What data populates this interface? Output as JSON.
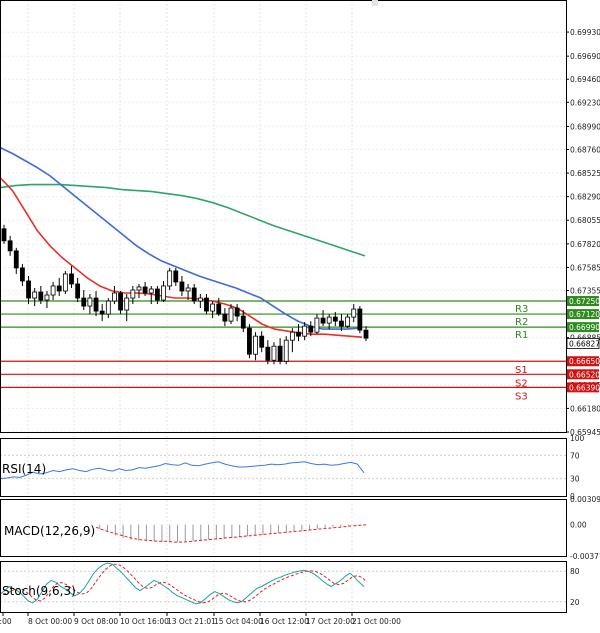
{
  "chart_data": {
    "type": "candlestick",
    "main": {
      "ylim": [
        0.65945,
        0.7015
      ],
      "yticks": [
        "0.69930",
        "0.69690",
        "0.69460",
        "0.69230",
        "0.68990",
        "0.68760",
        "0.68525",
        "0.68290",
        "0.68055",
        "0.67820",
        "0.67585",
        "0.67355",
        "0.67120",
        "0.66885",
        "0.66650",
        "0.66415",
        "0.66180",
        "0.65945"
      ],
      "xticks": [
        "20:00",
        "8 Oct 00:00",
        "9 Oct 08:00",
        "10 Oct 16:00",
        "13 Oct 21:01",
        "15 Oct 04:00",
        "16 Oct 12:00",
        "17 Oct 20:00",
        "21 Oct 00:00"
      ],
      "current_price": {
        "label": "0.66827",
        "value": 0.66827
      },
      "levels": [
        {
          "name": "R3",
          "label": "0.67250",
          "value": 0.6725,
          "color": "#2e8b1e"
        },
        {
          "name": "R2",
          "label": "0.67120",
          "value": 0.6712,
          "color": "#2e8b1e"
        },
        {
          "name": "R1",
          "label": "0.66990",
          "value": 0.6699,
          "color": "#2e8b1e"
        },
        {
          "name": "S1",
          "label": "0.66650",
          "value": 0.6665,
          "color": "#d41010"
        },
        {
          "name": "S2",
          "label": "0.66520",
          "value": 0.6652,
          "color": "#d41010"
        },
        {
          "name": "S3",
          "label": "0.66390",
          "value": 0.6639,
          "color": "#d41010"
        }
      ],
      "candles": [
        [
          0.6797,
          0.6801,
          0.6782,
          0.6785
        ],
        [
          0.6785,
          0.679,
          0.677,
          0.6775
        ],
        [
          0.6775,
          0.6778,
          0.6752,
          0.6758
        ],
        [
          0.6758,
          0.6762,
          0.674,
          0.6745
        ],
        [
          0.6745,
          0.675,
          0.6722,
          0.6728
        ],
        [
          0.6728,
          0.6738,
          0.672,
          0.6734
        ],
        [
          0.6734,
          0.674,
          0.6722,
          0.6726
        ],
        [
          0.6726,
          0.6735,
          0.6718,
          0.6731
        ],
        [
          0.6731,
          0.6744,
          0.6726,
          0.674
        ],
        [
          0.674,
          0.6748,
          0.673,
          0.6735
        ],
        [
          0.6735,
          0.6755,
          0.6732,
          0.6752
        ],
        [
          0.6752,
          0.676,
          0.6738,
          0.6742
        ],
        [
          0.6742,
          0.6748,
          0.6724,
          0.6728
        ],
        [
          0.6728,
          0.6736,
          0.6716,
          0.672
        ],
        [
          0.672,
          0.6732,
          0.6712,
          0.6728
        ],
        [
          0.6728,
          0.6735,
          0.671,
          0.6715
        ],
        [
          0.6715,
          0.6722,
          0.6705,
          0.6712
        ],
        [
          0.6712,
          0.6728,
          0.6708,
          0.6725
        ],
        [
          0.6725,
          0.674,
          0.6722,
          0.6733
        ],
        [
          0.6733,
          0.6735,
          0.6712,
          0.6716
        ],
        [
          0.6716,
          0.6732,
          0.6705,
          0.6728
        ],
        [
          0.6728,
          0.674,
          0.6722,
          0.6736
        ],
        [
          0.6736,
          0.6742,
          0.6728,
          0.6739
        ],
        [
          0.6739,
          0.6744,
          0.673,
          0.6733
        ],
        [
          0.6733,
          0.674,
          0.6722,
          0.6737
        ],
        [
          0.6737,
          0.674,
          0.6722,
          0.6726
        ],
        [
          0.6726,
          0.6745,
          0.6724,
          0.674
        ],
        [
          0.674,
          0.6758,
          0.6736,
          0.6755
        ],
        [
          0.6755,
          0.6758,
          0.674,
          0.6744
        ],
        [
          0.6744,
          0.675,
          0.673,
          0.6735
        ],
        [
          0.6735,
          0.6742,
          0.6726,
          0.6738
        ],
        [
          0.6738,
          0.6742,
          0.6722,
          0.6725
        ],
        [
          0.6725,
          0.6732,
          0.6718,
          0.6728
        ],
        [
          0.6728,
          0.6732,
          0.6712,
          0.6715
        ],
        [
          0.6715,
          0.6725,
          0.6708,
          0.6722
        ],
        [
          0.6722,
          0.6728,
          0.671,
          0.6712
        ],
        [
          0.6712,
          0.6718,
          0.67,
          0.6705
        ],
        [
          0.6705,
          0.6722,
          0.6702,
          0.6718
        ],
        [
          0.6718,
          0.6722,
          0.6705,
          0.671
        ],
        [
          0.671,
          0.6716,
          0.6694,
          0.6698
        ],
        [
          0.6698,
          0.6702,
          0.6668,
          0.6672
        ],
        [
          0.6672,
          0.6694,
          0.6666,
          0.669
        ],
        [
          0.669,
          0.6695,
          0.6674,
          0.6679
        ],
        [
          0.6679,
          0.6686,
          0.6662,
          0.6666
        ],
        [
          0.6666,
          0.6684,
          0.6662,
          0.668
        ],
        [
          0.668,
          0.6688,
          0.6662,
          0.6665
        ],
        [
          0.6665,
          0.669,
          0.6662,
          0.6686
        ],
        [
          0.6686,
          0.6698,
          0.6674,
          0.6694
        ],
        [
          0.6694,
          0.6702,
          0.6685,
          0.669
        ],
        [
          0.669,
          0.6704,
          0.6686,
          0.67
        ],
        [
          0.67,
          0.6705,
          0.669,
          0.6694
        ],
        [
          0.6694,
          0.6712,
          0.6692,
          0.6708
        ],
        [
          0.6708,
          0.6716,
          0.67,
          0.6703
        ],
        [
          0.6703,
          0.6712,
          0.6697,
          0.6709
        ],
        [
          0.6709,
          0.6714,
          0.67,
          0.6705
        ],
        [
          0.6705,
          0.6712,
          0.6695,
          0.67
        ],
        [
          0.67,
          0.6712,
          0.6698,
          0.6709
        ],
        [
          0.6709,
          0.6722,
          0.6704,
          0.6717
        ],
        [
          0.6717,
          0.672,
          0.6693,
          0.6696
        ],
        [
          0.6696,
          0.67,
          0.6685,
          0.6688
        ]
      ],
      "ma_blue": [
        0.6878,
        0.6872,
        0.6865,
        0.6858,
        0.685,
        0.684,
        0.683,
        0.682,
        0.681,
        0.68,
        0.679,
        0.678,
        0.6772,
        0.6765,
        0.676,
        0.6755,
        0.675,
        0.6746,
        0.6742,
        0.6738,
        0.6733,
        0.6728,
        0.672,
        0.6712,
        0.6705,
        0.67,
        0.6697,
        0.6697,
        0.6697,
        0.6698
      ],
      "ma_green": [
        0.6838,
        0.684,
        0.6841,
        0.6841,
        0.6841,
        0.684,
        0.6839,
        0.6838,
        0.6836,
        0.6835,
        0.6834,
        0.6832,
        0.683,
        0.6827,
        0.6823,
        0.6818,
        0.6812,
        0.6806,
        0.68,
        0.6795,
        0.679,
        0.6785,
        0.678,
        0.6775,
        0.677
      ],
      "ma_red": [
        0.6848,
        0.6835,
        0.6815,
        0.6795,
        0.678,
        0.6768,
        0.6758,
        0.6748,
        0.674,
        0.6735,
        0.6733,
        0.6733,
        0.6732,
        0.673,
        0.6728,
        0.6728,
        0.6727,
        0.6725,
        0.6722,
        0.6718,
        0.671,
        0.6702,
        0.6697,
        0.6695,
        0.6693,
        0.6692,
        0.6692,
        0.6691,
        0.669,
        0.6689
      ]
    },
    "rsi": {
      "label": "RSI(14)",
      "ylim": [
        0,
        100
      ],
      "yticks": [
        "100",
        "70",
        "30",
        "0"
      ],
      "values": [
        30,
        31,
        33,
        32,
        36,
        41,
        38,
        40,
        44,
        42,
        45,
        47,
        44,
        42,
        46,
        48,
        45,
        43,
        47,
        44,
        45,
        49,
        48,
        50,
        52,
        56,
        54,
        53,
        57,
        53,
        52,
        55,
        57,
        59,
        55,
        52,
        50,
        50,
        51,
        52,
        53,
        55,
        54,
        55,
        57,
        58,
        59,
        56,
        54,
        55,
        53,
        54,
        56,
        58,
        55,
        40
      ]
    },
    "macd": {
      "label": "MACD(12,26,9)",
      "ylim": [
        -0.003776,
        0.003093
      ],
      "yticks": [
        "0.003093",
        "0.00",
        "-0.003776"
      ],
      "histogram": [
        -0.0001,
        -0.0005,
        -0.0009,
        -0.0013,
        -0.0016,
        -0.0018,
        -0.0019,
        -0.002,
        -0.002,
        -0.0021,
        -0.0021,
        -0.0021,
        -0.002,
        -0.002,
        -0.0019,
        -0.0018,
        -0.0018,
        -0.0017,
        -0.0016,
        -0.0015,
        -0.0014,
        -0.0013,
        -0.0012,
        -0.0011,
        -0.001,
        -0.0009,
        -0.0008,
        -0.0007,
        -0.0006,
        -0.0005,
        -0.0004,
        -0.0003,
        -0.0002,
        -0.0001,
        -0.0001,
        0.0
      ],
      "signal": [
        -0.0003,
        -0.0007,
        -0.001,
        -0.0013,
        -0.0016,
        -0.0018,
        -0.0019,
        -0.002,
        -0.002,
        -0.0021,
        -0.0021,
        -0.002,
        -0.0019,
        -0.0018,
        -0.0017,
        -0.0016,
        -0.0015,
        -0.0014,
        -0.0013,
        -0.0012,
        -0.0011,
        -0.001,
        -0.0009,
        -0.0008,
        -0.0007,
        -0.0006,
        -0.0005,
        -0.0004,
        -0.0003,
        -0.0002,
        -0.0001,
        0.0
      ]
    },
    "stoch": {
      "label": "Stoch(9,6,3)",
      "ylim": [
        0,
        100
      ],
      "yticks": [
        "80",
        "20"
      ],
      "main": [
        35,
        42,
        50,
        45,
        40,
        32,
        22,
        18,
        25,
        40,
        55,
        62,
        58,
        50,
        45,
        38,
        32,
        36,
        46,
        60,
        75,
        85,
        92,
        96,
        94,
        86,
        78,
        68,
        58,
        48,
        42,
        48,
        55,
        62,
        58,
        52,
        46,
        38,
        32,
        28,
        24,
        20,
        16,
        18,
        26,
        34,
        40,
        36,
        30,
        24,
        20,
        18,
        22,
        30,
        38,
        46,
        50,
        55,
        60,
        65,
        68,
        72,
        75,
        78,
        80,
        82,
        80,
        76,
        70,
        62,
        55,
        50,
        56,
        62,
        70,
        76,
        68,
        58,
        50
      ]
    }
  }
}
